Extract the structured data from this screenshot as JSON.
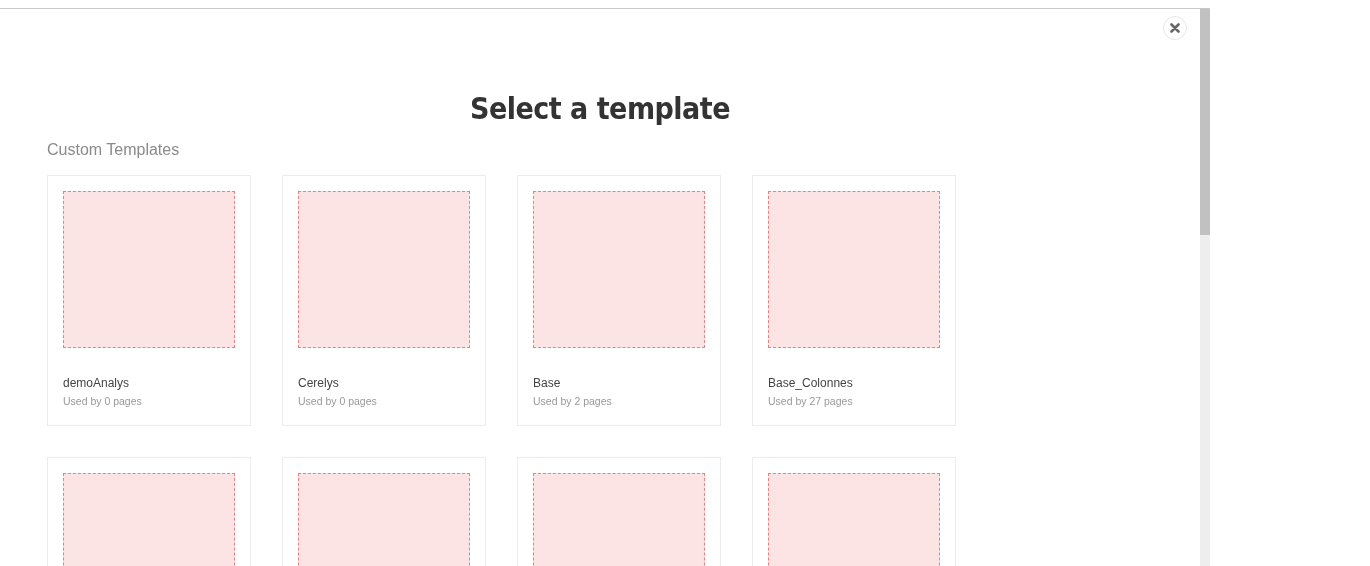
{
  "dialog": {
    "title": "Select a template",
    "section_title": "Custom Templates",
    "templates": [
      {
        "kind": "labeled",
        "name": "demoAnalys",
        "usage": "Used by 0 pages"
      },
      {
        "kind": "labeled",
        "name": "Cerelys",
        "usage": "Used by 0 pages"
      },
      {
        "kind": "labeled",
        "name": "Base",
        "usage": "Used by 2 pages"
      },
      {
        "kind": "labeled",
        "name": "Base_Colonnes",
        "usage": "Used by 27 pages"
      },
      {
        "kind": "cutoff"
      },
      {
        "kind": "cutoff"
      },
      {
        "kind": "cutoff"
      },
      {
        "kind": "cutoff"
      }
    ]
  }
}
